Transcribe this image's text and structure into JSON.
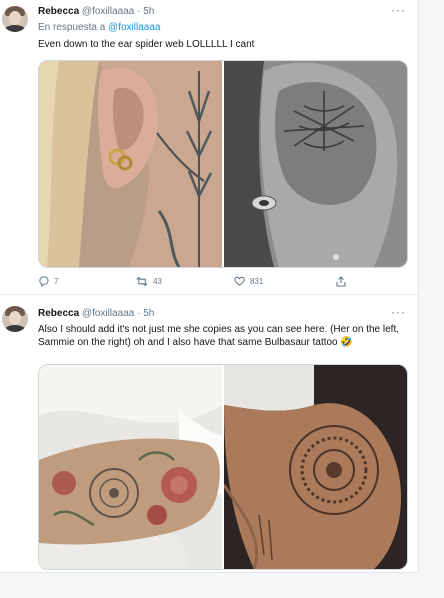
{
  "tweets": [
    {
      "name": "Rebecca",
      "handle": "@foxillaaaa",
      "time": "5h",
      "more": "···",
      "reply_prefix": "En respuesta a",
      "reply_to": "@foxillaaaa",
      "text": "Even down to the ear spider web LOLLLLL I cant",
      "stats": {
        "replies": "7",
        "retweets": "43",
        "likes": "831"
      }
    },
    {
      "name": "Rebecca",
      "handle": "@foxillaaaa",
      "time": "5h",
      "more": "···",
      "text": "Also I should add it's not just me she copies as you can see here. (Her on the left, Sammie on the right) oh and I also have that same Bulbasaur tattoo 🤣"
    }
  ],
  "icons": [
    "reply-icon",
    "retweet-icon",
    "like-icon",
    "share-icon",
    "more-icon"
  ],
  "colors": {
    "link": "#1b95e0",
    "muted": "#657786",
    "text": "#14171a"
  }
}
